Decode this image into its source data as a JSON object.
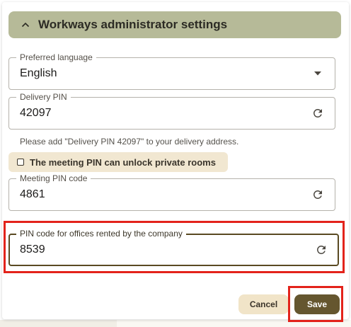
{
  "header": {
    "title": "Workways administrator settings"
  },
  "language": {
    "label": "Preferred language",
    "value": "English"
  },
  "delivery_pin": {
    "label": "Delivery PIN",
    "value": "42097"
  },
  "helper_text": "Please add \"Delivery PIN 42097\" to your delivery address.",
  "meeting_checkbox": {
    "label": "The meeting PIN can unlock private rooms",
    "checked": false
  },
  "meeting_pin": {
    "label": "Meeting PIN code",
    "value": "4861"
  },
  "office_pin": {
    "label": "PIN code for offices rented by the company",
    "value": "8539"
  },
  "buttons": {
    "cancel": "Cancel",
    "save": "Save"
  },
  "icons": {
    "collapse": "chevron-up-icon",
    "dropdown": "dropdown-arrow-icon",
    "refresh": "refresh-icon"
  },
  "colors": {
    "header_bg": "#b6ba98",
    "primary": "#65562f",
    "chip_bg": "#f1e7d1",
    "highlight": "#e3231b"
  }
}
